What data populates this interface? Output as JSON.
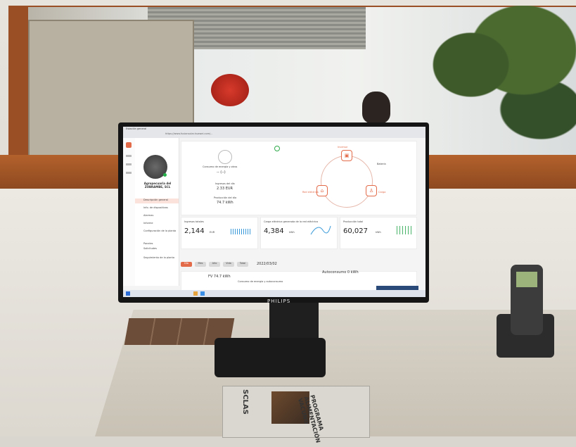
{
  "monitor": {
    "brand": "PHILIPS"
  },
  "browser": {
    "tab_title": "Estación general",
    "address": "https://www.fusionsolar.huawei.com/..."
  },
  "app": {
    "plant_name": "Agropecuaria del ZOBRAMBE, SCL",
    "menu": [
      "Descripción general",
      "Info. de dispositivos",
      "Alarmas",
      "Informe",
      "Configuración de la planta",
      "Paneles",
      "Solicitudes",
      "Seguimiento de la planta"
    ],
    "overview": {
      "left_label": "Consumo de energía y otros",
      "left_value": "-- (--)",
      "revenue_label": "Ingresos del día",
      "revenue_value": "2.33 EUR",
      "production_label": "Producción del día",
      "production_value": "74.7 kWh",
      "grid_label": "Red eléctrica",
      "inverter_label": "Inversor",
      "load_label": "Carga",
      "battery_label": "Batería"
    },
    "stats": [
      {
        "label": "Ingresos totales",
        "value": "2,144",
        "unit": "EUR"
      },
      {
        "label": "Carga eléctrica generada de la red eléctrica",
        "value": "4,384",
        "unit": "kWh"
      },
      {
        "label": "Producción total",
        "value": "60,027",
        "unit": "kWh"
      }
    ],
    "date_tabs": [
      "Día",
      "Mes",
      "Año",
      "Vida",
      "Total"
    ],
    "date_value": "2022/03/02",
    "bottom": {
      "pv_label": "FV 74.7 kWh",
      "consumption_label": "Consumo de energía y autoconsumo",
      "self_consumption_label": "Autoconsumo 0 kWh"
    }
  },
  "brochure": {
    "title": "PROGRAMA ALIMENTACIÓN VACUNO",
    "logo": "SCLAS"
  }
}
